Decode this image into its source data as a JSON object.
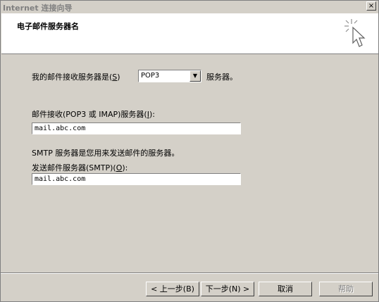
{
  "window": {
    "title": "Internet 连接向导",
    "close_label": "×"
  },
  "header": {
    "title": "电子邮件服务器名"
  },
  "form": {
    "incoming_type_prefix": "我的邮件接收服务器是",
    "incoming_type_hotkey": "S",
    "incoming_type_value": "POP3",
    "incoming_type_suffix": "服务器。",
    "incoming_server_label_prefix": "邮件接收(POP3 或 IMAP)服务器(",
    "incoming_server_label_hotkey": "I",
    "incoming_server_label_suffix": "):",
    "incoming_server_value": "mail.abc.com",
    "smtp_note": "SMTP 服务器是您用来发送邮件的服务器。",
    "outgoing_server_label_prefix": "发送邮件服务器(SMTP)(",
    "outgoing_server_label_hotkey": "O",
    "outgoing_server_label_suffix": "):",
    "outgoing_server_value": "mail.abc.com"
  },
  "buttons": {
    "back": "< 上一步(B)",
    "next": "下一步(N) >",
    "cancel": "取消",
    "help": "帮助"
  }
}
